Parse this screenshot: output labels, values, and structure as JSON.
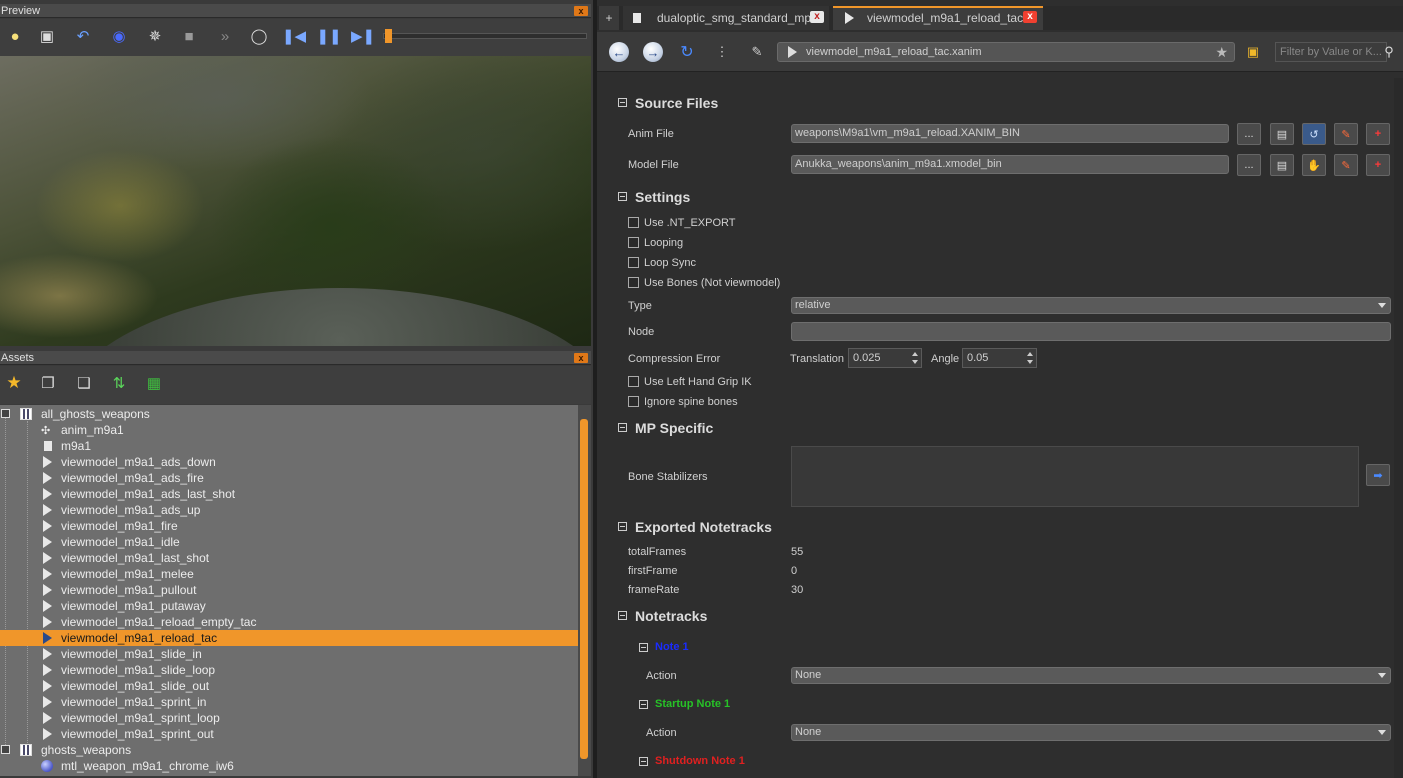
{
  "preview": {
    "title": "Preview",
    "close": "x"
  },
  "assets": {
    "title": "Assets",
    "close": "x"
  },
  "tree": {
    "groups": [
      {
        "label": "all_ghosts_weapons"
      },
      {
        "label": "ghosts_weapons"
      }
    ],
    "items": [
      {
        "label": "anim_m9a1",
        "icon": "knot-icon"
      },
      {
        "label": "m9a1",
        "icon": "doc-icon"
      },
      {
        "label": "viewmodel_m9a1_ads_down",
        "icon": "play-icon"
      },
      {
        "label": "viewmodel_m9a1_ads_fire",
        "icon": "play-icon"
      },
      {
        "label": "viewmodel_m9a1_ads_last_shot",
        "icon": "play-icon"
      },
      {
        "label": "viewmodel_m9a1_ads_up",
        "icon": "play-icon"
      },
      {
        "label": "viewmodel_m9a1_fire",
        "icon": "play-icon"
      },
      {
        "label": "viewmodel_m9a1_idle",
        "icon": "play-icon"
      },
      {
        "label": "viewmodel_m9a1_last_shot",
        "icon": "play-icon"
      },
      {
        "label": "viewmodel_m9a1_melee",
        "icon": "play-icon"
      },
      {
        "label": "viewmodel_m9a1_pullout",
        "icon": "play-icon"
      },
      {
        "label": "viewmodel_m9a1_putaway",
        "icon": "play-icon"
      },
      {
        "label": "viewmodel_m9a1_reload_empty_tac",
        "icon": "play-icon"
      },
      {
        "label": "viewmodel_m9a1_reload_tac",
        "icon": "play-icon",
        "selected": true
      },
      {
        "label": "viewmodel_m9a1_slide_in",
        "icon": "play-icon"
      },
      {
        "label": "viewmodel_m9a1_slide_loop",
        "icon": "play-icon"
      },
      {
        "label": "viewmodel_m9a1_slide_out",
        "icon": "play-icon"
      },
      {
        "label": "viewmodel_m9a1_sprint_in",
        "icon": "play-icon"
      },
      {
        "label": "viewmodel_m9a1_sprint_loop",
        "icon": "play-icon"
      },
      {
        "label": "viewmodel_m9a1_sprint_out",
        "icon": "play-icon"
      }
    ],
    "ghost_item": {
      "label": "mtl_weapon_m9a1_chrome_iw6",
      "icon": "material-ball-icon"
    }
  },
  "tabs": {
    "new": "+",
    "items": [
      {
        "label": "dualoptic_smg_standard_mp",
        "close": "x"
      },
      {
        "label": "viewmodel_m9a1_reload_tac",
        "close": "x"
      }
    ]
  },
  "nav": {
    "address": "viewmodel_m9a1_reload_tac.xanim",
    "filter_placeholder": "Filter by Value or K..."
  },
  "sections": {
    "source_files": "Source Files",
    "settings": "Settings",
    "mp_specific": "MP Specific",
    "exported_notetracks": "Exported Notetracks",
    "notetracks": "Notetracks"
  },
  "source": {
    "anim_label": "Anim File",
    "anim_value": "weapons\\M9a1\\vm_m9a1_reload.XANIM_BIN",
    "model_label": "Model File",
    "model_value": "Anukka_weapons\\anim_m9a1.xmodel_bin",
    "browse": "..."
  },
  "settings": {
    "use_nt_export": "Use .NT_EXPORT",
    "looping": "Looping",
    "loop_sync": "Loop Sync",
    "use_bones": "Use Bones (Not viewmodel)",
    "type_label": "Type",
    "type_value": "relative",
    "node_label": "Node",
    "node_value": "",
    "compression_label": "Compression Error",
    "translation_label": "Translation",
    "translation_value": "0.025",
    "angle_label": "Angle",
    "angle_value": "0.05",
    "left_hand": "Use Left Hand Grip IK",
    "ignore_spine": "Ignore spine bones"
  },
  "mp": {
    "bone_stabilizers_label": "Bone Stabilizers"
  },
  "exported": {
    "total_frames_label": "totalFrames",
    "total_frames": "55",
    "first_frame_label": "firstFrame",
    "first_frame": "0",
    "frame_rate_label": "frameRate",
    "frame_rate": "30"
  },
  "notetracks": {
    "note1": "Note 1",
    "startup": "Startup Note 1",
    "shutdown": "Shutdown Note 1",
    "action_label": "Action",
    "action_value": "None"
  },
  "colors": {
    "accent": "#f0962a",
    "note1": "#1a2cff",
    "startup": "#27c227",
    "shutdown": "#e02020"
  }
}
